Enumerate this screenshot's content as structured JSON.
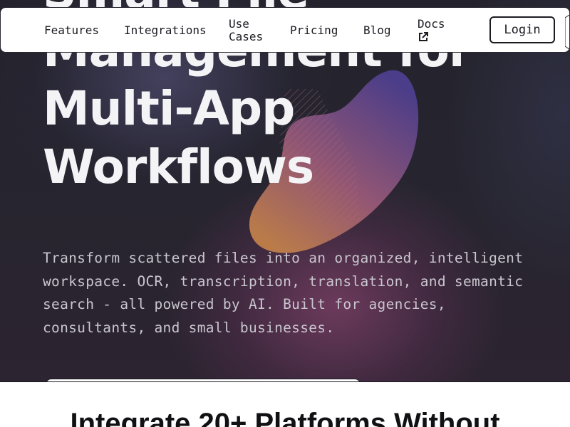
{
  "hero": {
    "headline_lines": [
      "Smart File",
      "Management for",
      "Multi-App",
      "Workflows"
    ],
    "subtitle": "Transform scattered files into an organized, intelligent workspace. OCR, transcription, translation, and semantic search - all powered by AI. Built for agencies, consultants, and small businesses."
  },
  "nav": {
    "items": [
      {
        "label": "Features"
      },
      {
        "label": "Integrations"
      },
      {
        "label": "Use Cases"
      },
      {
        "label": "Pricing"
      },
      {
        "label": "Blog"
      },
      {
        "label": "Docs",
        "icon": "external-link-icon"
      }
    ],
    "login_label": "Login"
  },
  "section": {
    "heading": "Integrate 20+ Platforms Without"
  },
  "colors": {
    "hero_bg": "#26252f",
    "nav_bg": "#ffffff",
    "text_dark": "#1b1b22",
    "headline": "#f4f4f6",
    "subtitle": "#c9c6cf",
    "blob_purple": "#5b3f8c",
    "blob_orange": "#c07a46"
  }
}
